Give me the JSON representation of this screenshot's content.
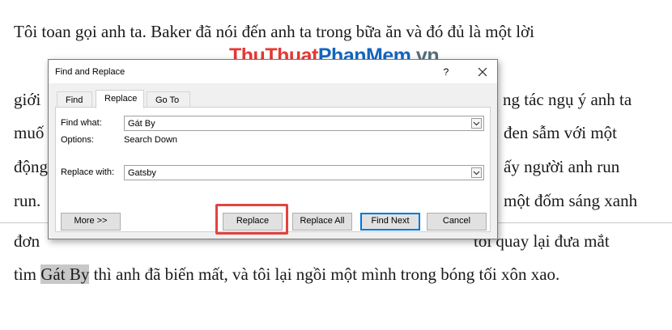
{
  "document": {
    "lines": [
      "Tôi toan gọi anh ta. Baker đã nói đến anh ta trong bữa ăn và đó đủ là một lời",
      "giới",
      "ng tác ngụ ý anh ta",
      "muố",
      "đen sẫm với một",
      "động",
      "ấy người anh run",
      "run.",
      "một đốm sáng xanh",
      "đơn",
      "tôi quay lại đưa mắt"
    ],
    "last_line_prefix": "tìm ",
    "last_line_highlight": "Gát By",
    "last_line_suffix": " thì anh đã biến mất, và tôi lại ngồi một mình trong bóng tối xôn xao."
  },
  "watermark": {
    "part1": "Thu",
    "part2": "Thuat",
    "part3": "Phan",
    "part4": "Mem",
    "part5": ".vn"
  },
  "dialog": {
    "title": "Find and Replace",
    "help": "?",
    "tabs": {
      "find": "Find",
      "replace": "Replace",
      "goto": "Go To"
    },
    "find_what_label": "Find what:",
    "find_what_value": "Gát By",
    "options_label": "Options:",
    "options_value": "Search Down",
    "replace_with_label": "Replace with:",
    "replace_with_value": "Gatsby",
    "buttons": {
      "more": "More >>",
      "replace": "Replace",
      "replace_all": "Replace All",
      "find_next": "Find Next",
      "cancel": "Cancel"
    }
  },
  "colors": {
    "highlight_box": "#e0443f",
    "default_button_border": "#0078d7"
  }
}
